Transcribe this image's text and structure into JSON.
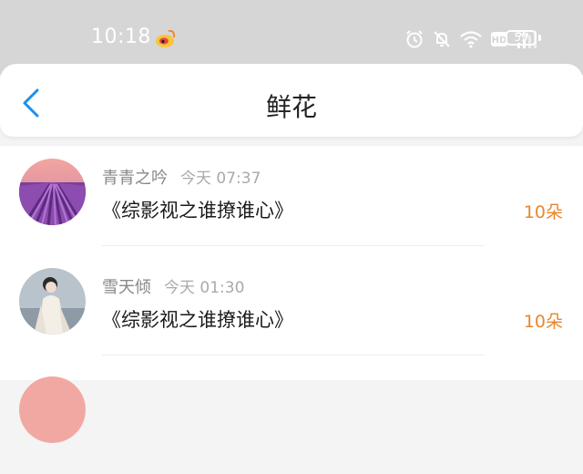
{
  "status_bar": {
    "time": "10:18",
    "battery": "59",
    "icons": [
      "weibo-icon",
      "alarm-icon",
      "mute-icon",
      "wifi-icon",
      "hd-icon",
      "signal-5g-icon",
      "battery-icon"
    ]
  },
  "nav": {
    "title": "鲜花",
    "back_icon": "chevron-left-icon"
  },
  "colors": {
    "accent": "#1a8ff0",
    "count": "#e8872e",
    "status_bar_bg": "#d6d6d6"
  },
  "flowers": [
    {
      "user": "青青之吟",
      "time": "今天 07:37",
      "work": "《综影视之谁撩谁心》",
      "count": "10朵"
    },
    {
      "user": "雪天倾",
      "time": "今天 01:30",
      "work": "《综影视之谁撩谁心》",
      "count": "10朵"
    }
  ]
}
